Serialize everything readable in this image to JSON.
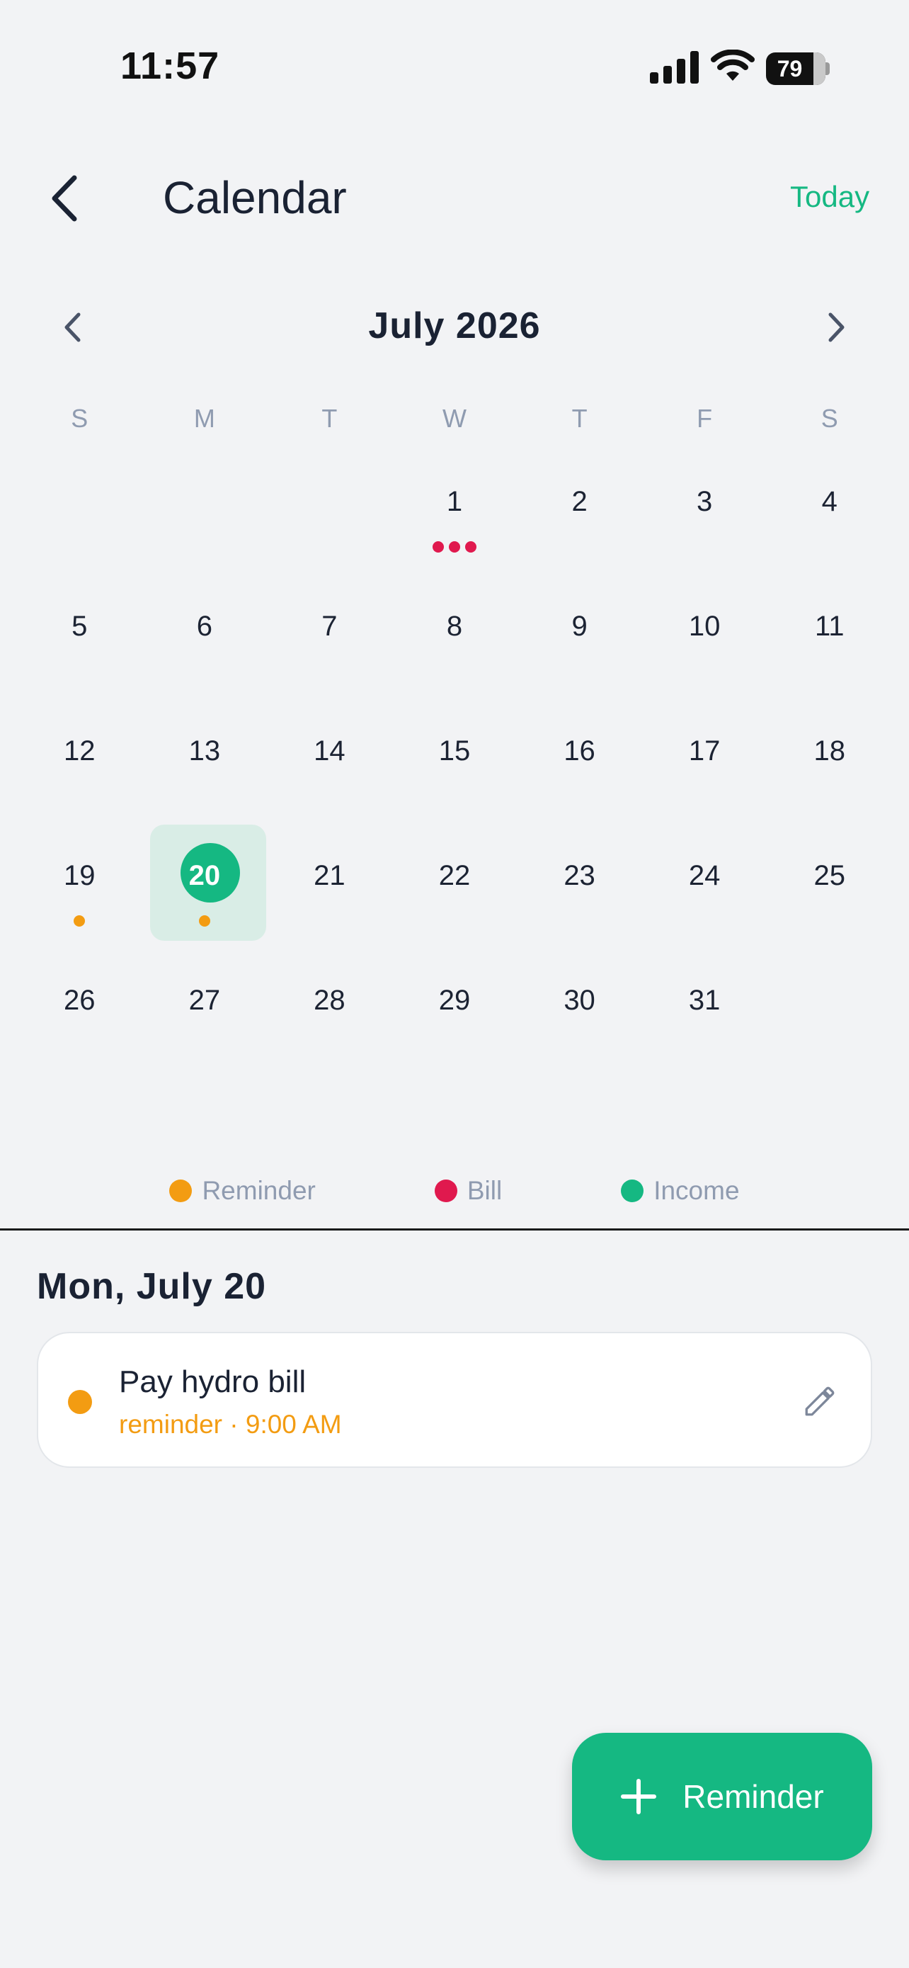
{
  "status_bar": {
    "time": "11:57",
    "battery": "79"
  },
  "header": {
    "title": "Calendar",
    "today_label": "Today"
  },
  "calendar": {
    "month_label": "July 2026",
    "weekdays": [
      "S",
      "M",
      "T",
      "W",
      "T",
      "F",
      "S"
    ],
    "leading_blanks": 3,
    "days": [
      {
        "n": "1",
        "dots": [
          "#e0194e",
          "#e0194e",
          "#e0194e"
        ]
      },
      {
        "n": "2"
      },
      {
        "n": "3"
      },
      {
        "n": "4"
      },
      {
        "n": "5"
      },
      {
        "n": "6"
      },
      {
        "n": "7"
      },
      {
        "n": "8"
      },
      {
        "n": "9"
      },
      {
        "n": "10"
      },
      {
        "n": "11"
      },
      {
        "n": "12"
      },
      {
        "n": "13"
      },
      {
        "n": "14"
      },
      {
        "n": "15"
      },
      {
        "n": "16"
      },
      {
        "n": "17"
      },
      {
        "n": "18"
      },
      {
        "n": "19",
        "dots": [
          "#f39c12"
        ]
      },
      {
        "n": "20",
        "dots": [
          "#f39c12"
        ],
        "selected": true
      },
      {
        "n": "21"
      },
      {
        "n": "22"
      },
      {
        "n": "23"
      },
      {
        "n": "24"
      },
      {
        "n": "25"
      },
      {
        "n": "26"
      },
      {
        "n": "27"
      },
      {
        "n": "28"
      },
      {
        "n": "29"
      },
      {
        "n": "30"
      },
      {
        "n": "31"
      }
    ]
  },
  "legend": [
    {
      "label": "Reminder",
      "color": "#f39c12"
    },
    {
      "label": "Bill",
      "color": "#e0194e"
    },
    {
      "label": "Income",
      "color": "#15b882"
    }
  ],
  "selected_day": {
    "label": "Mon, July 20",
    "events": [
      {
        "title": "Pay hydro bill",
        "meta": "reminder · 9:00 AM",
        "color": "#f39c12",
        "icon": "pencil-icon"
      }
    ]
  },
  "fab": {
    "label": "Reminder",
    "icon": "plus-icon"
  },
  "colors": {
    "accent": "#15b882",
    "background": "#f2f3f5"
  }
}
